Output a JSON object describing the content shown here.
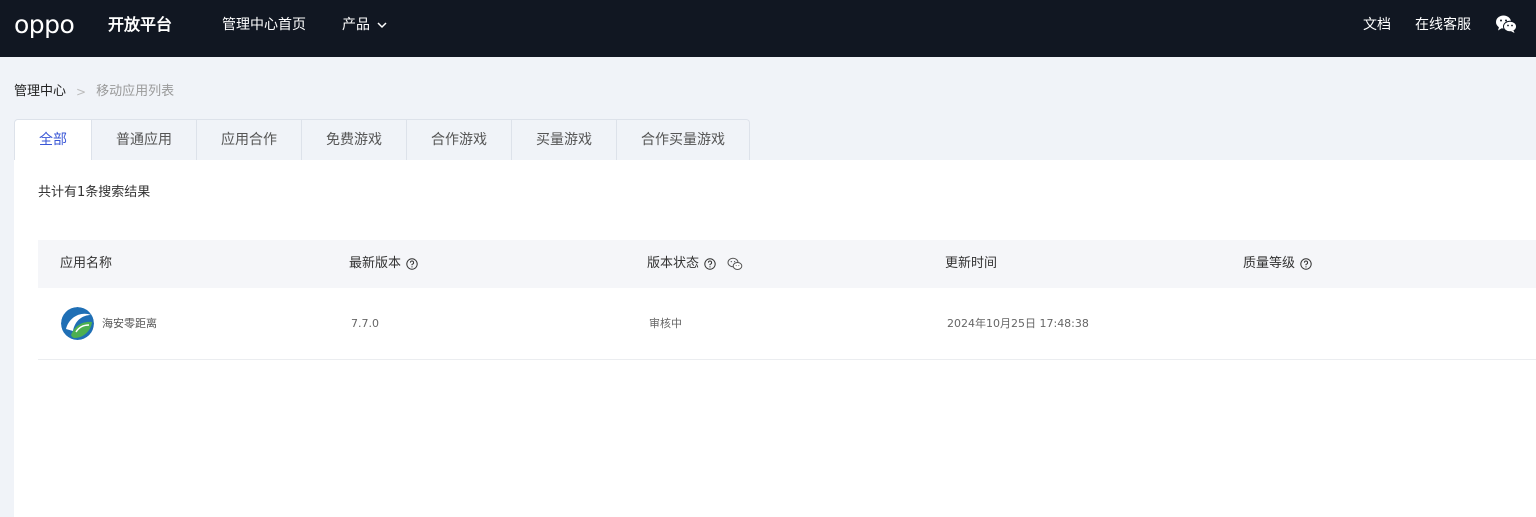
{
  "header": {
    "logo": "oppo",
    "brand_sub": "开放平台",
    "nav_home": "管理中心首页",
    "nav_products": "产品",
    "nav_docs": "文档",
    "nav_support": "在线客服"
  },
  "breadcrumb": {
    "home": "管理中心",
    "separator": ">",
    "current": "移动应用列表"
  },
  "tabs": [
    {
      "label": "全部",
      "active": true
    },
    {
      "label": "普通应用"
    },
    {
      "label": "应用合作"
    },
    {
      "label": "免费游戏"
    },
    {
      "label": "合作游戏"
    },
    {
      "label": "买量游戏"
    },
    {
      "label": "合作买量游戏"
    }
  ],
  "result_count": "共计有1条搜索结果",
  "table": {
    "columns": [
      "应用名称",
      "最新版本",
      "版本状态",
      "更新时间",
      "质量等级"
    ],
    "rows": [
      {
        "name": "海安零距离",
        "version": "7.7.0",
        "status": "审核中",
        "updated": "2024年10月25日 17:48:38",
        "quality": ""
      }
    ]
  },
  "colors": {
    "topbar": "#111722",
    "accent": "#3a57d6",
    "background": "#f0f3f8"
  }
}
